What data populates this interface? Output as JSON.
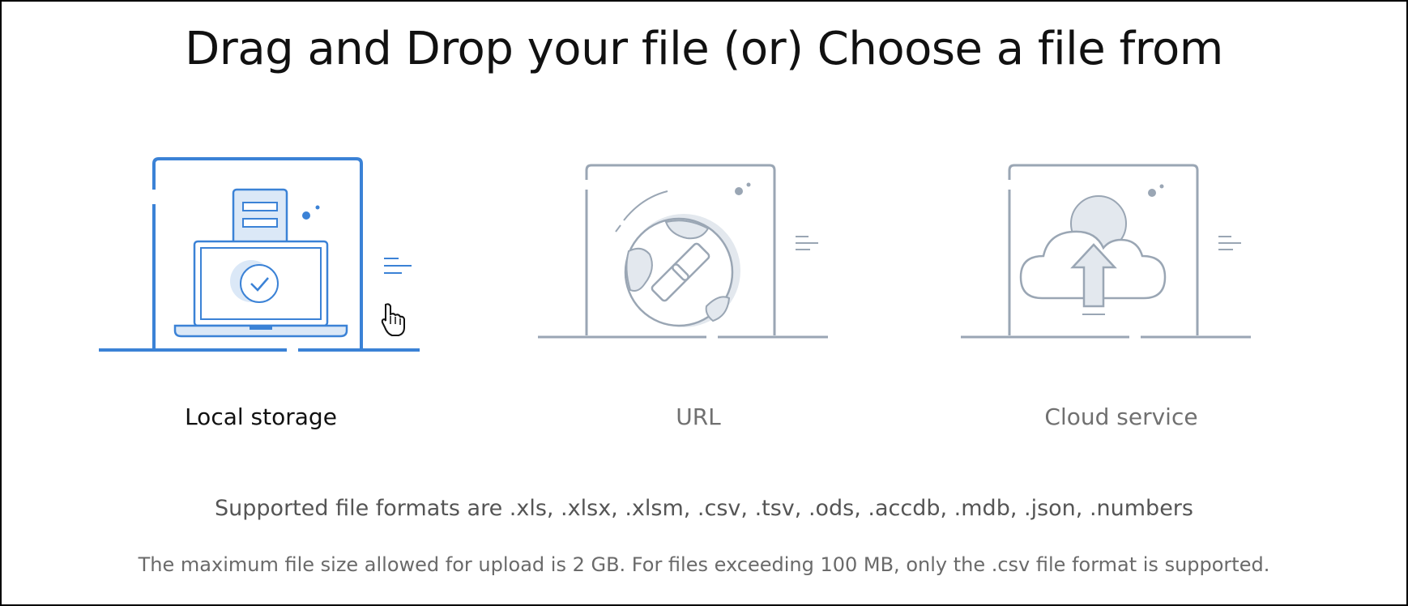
{
  "page": {
    "title": "Drag and Drop your file (or) Choose a file from"
  },
  "options": [
    {
      "id": "local",
      "label": "Local storage",
      "icon": "laptop-upload-icon",
      "active": true
    },
    {
      "id": "url",
      "label": "URL",
      "icon": "globe-link-icon",
      "active": false
    },
    {
      "id": "cloud",
      "label": "Cloud service",
      "icon": "cloud-upload-icon",
      "active": false
    }
  ],
  "info": {
    "formats": "Supported file formats are .xls, .xlsx, .xlsm, .csv, .tsv, .ods, .accdb, .mdb, .json, .numbers",
    "max_size": "The maximum file size allowed for upload is 2 GB. For files exceeding 100 MB, only the .csv file format is supported."
  },
  "colors": {
    "accent": "#3b82d6",
    "accent_fill": "#dbe8f7",
    "muted_stroke": "#9aa6b4",
    "muted_fill": "#e3e8ee"
  },
  "cursor_icon": "hand-pointer-icon"
}
